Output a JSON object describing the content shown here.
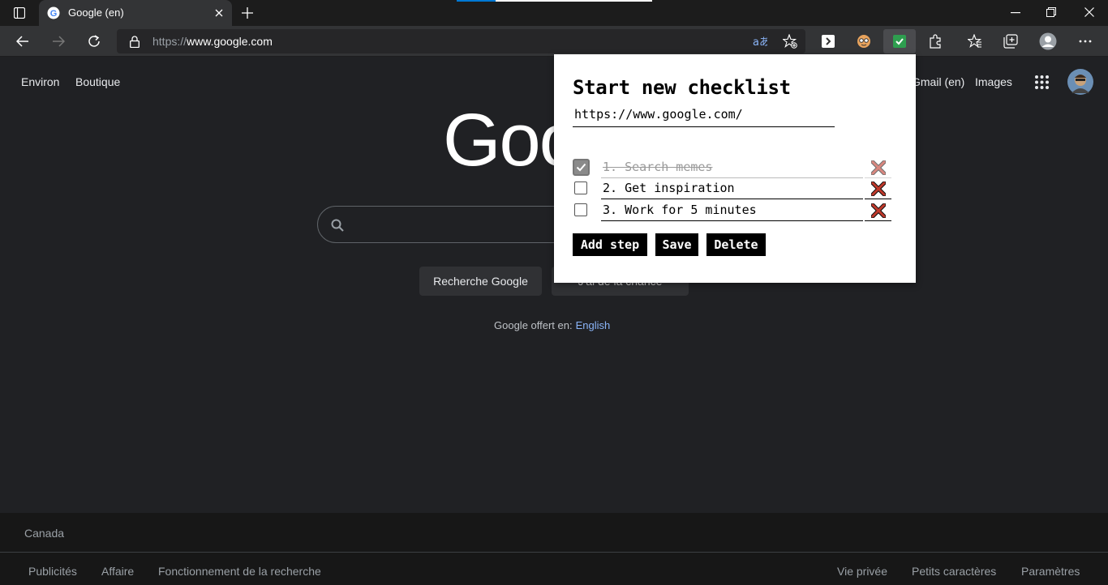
{
  "browser": {
    "tab_title": "Google (en)",
    "url_prefix": "https://",
    "url_host": "www.google.com",
    "accent": "#0078d4"
  },
  "google": {
    "top_left_links": [
      "Environ",
      "Boutique"
    ],
    "top_right_links": [
      "Gmail (en)",
      "Images"
    ],
    "logo_text": "Goo",
    "search_button": "Recherche Google",
    "lucky_button": "J'ai de la chance",
    "lucky_visible_fragment": "J'ai de la chance",
    "offered_label": "Google offert en:",
    "offered_language": "English",
    "footer_country": "Canada",
    "footer_left": [
      "Publicités",
      "Affaire",
      "Fonctionnement de la recherche"
    ],
    "footer_right": [
      "Vie privée",
      "Petits caractères",
      "Paramètres"
    ]
  },
  "popup": {
    "title": "Start new checklist",
    "url_value": "https://www.google.com/",
    "steps": [
      {
        "text": "1. Search memes",
        "checked": true
      },
      {
        "text": "2. Get inspiration",
        "checked": false
      },
      {
        "text": "3. Work for 5 minutes",
        "checked": false
      }
    ],
    "buttons": {
      "add_step": "Add step",
      "save": "Save",
      "delete": "Delete"
    },
    "delete_color": "#c0392b"
  }
}
